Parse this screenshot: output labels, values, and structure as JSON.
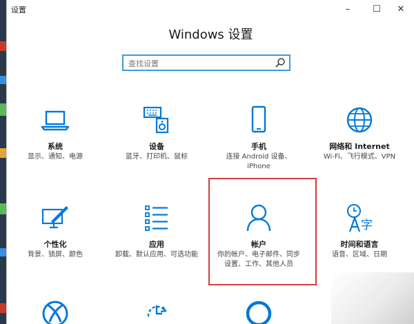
{
  "window": {
    "title": "设置",
    "controls": {
      "minimize": "–",
      "maximize": "☐",
      "close": "✕"
    }
  },
  "header": {
    "title": "Windows 设置"
  },
  "search": {
    "placeholder": "查找设置"
  },
  "tiles": [
    {
      "name": "系统",
      "desc": "显示、通知、电源",
      "icon": "laptop-icon"
    },
    {
      "name": "设备",
      "desc": "蓝牙、打印机、鼠标",
      "icon": "devices-icon"
    },
    {
      "name": "手机",
      "desc": "连接 Android 设备、iPhone",
      "icon": "phone-icon"
    },
    {
      "name": "网络和 Internet",
      "desc": "Wi-Fi、飞行模式、VPN",
      "icon": "globe-icon"
    },
    {
      "name": "个性化",
      "desc": "背景、锁屏、颜色",
      "icon": "personalize-icon"
    },
    {
      "name": "应用",
      "desc": "卸载、默认应用、可选功能",
      "icon": "apps-icon"
    },
    {
      "name": "帐户",
      "desc": "你的帐户、电子邮件、同步设置、工作、其他人员",
      "icon": "account-icon",
      "highlighted": true
    },
    {
      "name": "时间和语言",
      "desc": "语音、区域、日期",
      "icon": "time-language-icon"
    }
  ],
  "colors": {
    "accent": "#0078d7",
    "highlight_border": "#d23b3b",
    "search_border": "#3c9ad6"
  }
}
